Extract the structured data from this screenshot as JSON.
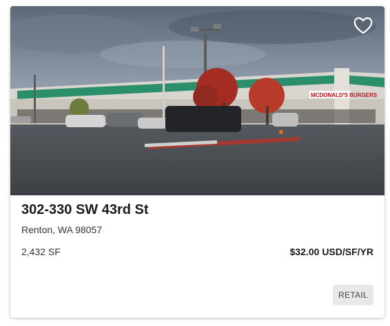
{
  "listing": {
    "title": "302-330 SW 43rd St",
    "location": "Renton, WA 98057",
    "size": "2,432 SF",
    "price": "$32.00 USD/SF/YR",
    "type_tag": "RETAIL",
    "favorite_icon": "heart-outline-icon",
    "photo": {
      "sign_text": "MCDONALD'S BURGERS"
    }
  }
}
